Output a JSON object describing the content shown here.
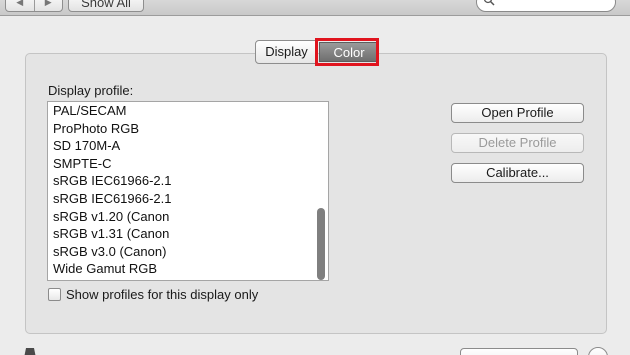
{
  "toolbar": {
    "back_icon": "back-arrow-icon",
    "forward_icon": "forward-arrow-icon",
    "back_glyph": "◀",
    "forward_glyph": "▶",
    "show_all_label": "Show All",
    "search_placeholder": ""
  },
  "tabs": [
    {
      "label": "Display",
      "selected": false
    },
    {
      "label": "Color",
      "selected": true
    }
  ],
  "panel": {
    "list_label": "Display profile:",
    "profiles": [
      "PAL/SECAM",
      "ProPhoto RGB",
      "SD 170M-A",
      "SMPTE-C",
      "sRGB IEC61966-2.1",
      "sRGB IEC61966-2.1",
      "sRGB v1.20 (Canon",
      "sRGB v1.31 (Canon",
      "sRGB v3.0 (Canon)",
      "Wide Gamut RGB"
    ],
    "checkbox_label": "Show profiles for this display only",
    "checkbox_checked": false
  },
  "buttons": {
    "open_profile": "Open Profile",
    "delete_profile": "Delete Profile",
    "calibrate": "Calibrate..."
  },
  "colors": {
    "highlight": "#e0141e",
    "selected_tab": "#7f7f7f"
  }
}
